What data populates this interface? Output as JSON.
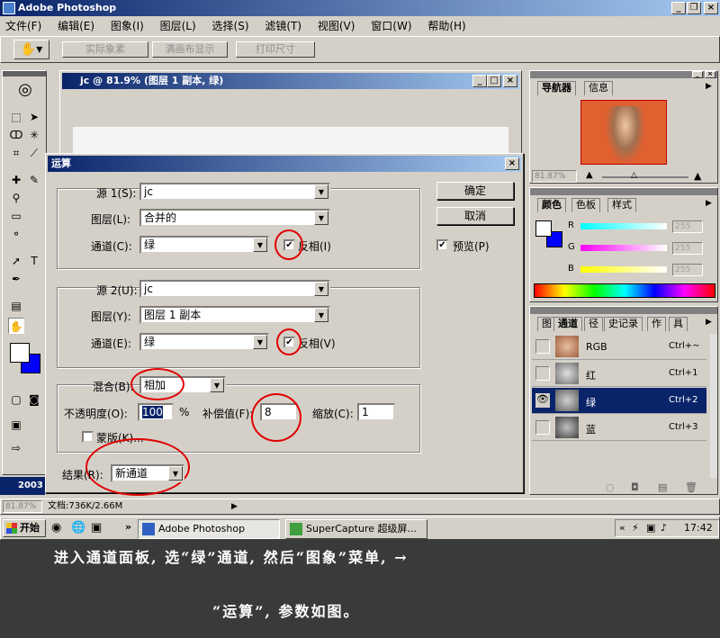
{
  "app": {
    "title": "Adobe Photoshop"
  },
  "menu": [
    "文件(F)",
    "编辑(E)",
    "图象(I)",
    "图层(L)",
    "选择(S)",
    "滤镜(T)",
    "视图(V)",
    "窗口(W)",
    "帮助(H)"
  ],
  "options_bar": {
    "btn1": "实际象素",
    "btn2": "满画布显示",
    "btn3": "打印尺寸"
  },
  "doc_window": {
    "title": "jc @ 81.9% (图层 1 副本, 绿)"
  },
  "dialog": {
    "title": "运算",
    "source1": {
      "label": "源 1(S):",
      "value": "jc",
      "layer_label": "图层(L):",
      "layer_value": "合并的",
      "channel_label": "通道(C):",
      "channel_value": "绿",
      "invert_label": "反相(I)"
    },
    "source2": {
      "label": "源 2(U):",
      "value": "jc",
      "layer_label": "图层(Y):",
      "layer_value": "图层 1 副本",
      "channel_label": "通道(E):",
      "channel_value": "绿",
      "invert_label": "反相(V)"
    },
    "blend": {
      "label": "混合(B):",
      "value": "相加",
      "opacity_label": "不透明度(O):",
      "opacity_value": "100",
      "opacity_unit": "%",
      "offset_label": "补偿值(F):",
      "offset_value": "8",
      "scale_label": "缩放(C):",
      "scale_value": "1",
      "mask_label": "蒙版(K)..."
    },
    "result": {
      "label": "结果(R):",
      "value": "新通道"
    },
    "ok": "确定",
    "cancel": "取消",
    "preview": "预览(P)"
  },
  "navigator": {
    "tab1": "导航器",
    "tab2": "信息",
    "zoom": "81.87%"
  },
  "color_panel": {
    "tab1": "颜色",
    "tab2": "色板",
    "tab3": "样式",
    "r_label": "R",
    "g_label": "G",
    "b_label": "B",
    "r_value": "255",
    "g_value": "255",
    "b_value": "255"
  },
  "channels_panel": {
    "tabs": [
      "图",
      "通道",
      "径",
      "史记录",
      "作",
      "具"
    ],
    "rows": [
      {
        "name": "RGB",
        "shortcut": "Ctrl+~"
      },
      {
        "name": "红",
        "shortcut": "Ctrl+1"
      },
      {
        "name": "绿",
        "shortcut": "Ctrl+2"
      },
      {
        "name": "蓝",
        "shortcut": "Ctrl+3"
      }
    ]
  },
  "status": {
    "zoom": "81.87%",
    "doc": "文档:736K/2.66M",
    "year": "2003"
  },
  "taskbar": {
    "start": "开始",
    "task1": "Adobe Photoshop",
    "task2": "SuperCapture 超级屏...",
    "arrows": "«",
    "more": "»",
    "time": "17:42"
  },
  "caption": {
    "line1": "进入通道面板, 选“绿”通道, 然后“图象”菜单, →",
    "line2": "“运算”, 参数如图。"
  },
  "colors": {
    "title_blue": "#0a246a",
    "selection": "#0a246a",
    "annotation_red": "#e00000",
    "caption_bg": "#3a3a3a"
  }
}
